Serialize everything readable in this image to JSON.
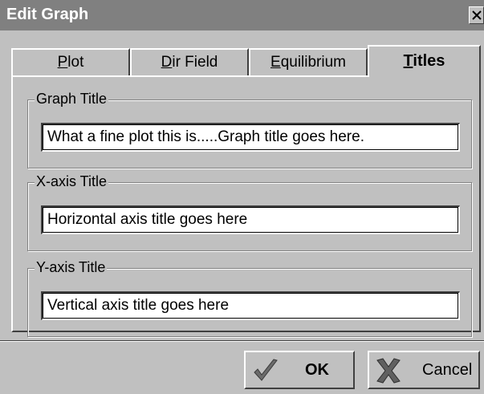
{
  "window": {
    "title": "Edit Graph",
    "close_glyph": "✕"
  },
  "tabs": [
    {
      "label_mnemonic": "P",
      "label_rest": "lot",
      "active": false
    },
    {
      "label_mnemonic": "D",
      "label_rest": "ir Field",
      "active": false
    },
    {
      "label_mnemonic": "E",
      "label_rest": "quilibrium",
      "active": false
    },
    {
      "label_mnemonic": "T",
      "label_rest": "itles",
      "active": true
    }
  ],
  "groups": {
    "graph_title": {
      "legend": "Graph Title",
      "value": "What a fine plot this is.....Graph title goes here."
    },
    "x_axis_title": {
      "legend": "X-axis Title",
      "value": "Horizontal axis title goes here"
    },
    "y_axis_title": {
      "legend": "Y-axis Title",
      "value": "Vertical axis title goes here"
    }
  },
  "buttons": {
    "ok": {
      "label": "OK",
      "icon": "checkmark-icon"
    },
    "cancel": {
      "label": "Cancel",
      "icon": "x-icon"
    }
  },
  "colors": {
    "face": "#c0c0c0",
    "titlebar": "#808080",
    "ok_check": "#6b6b6b",
    "cancel_x": "#606060"
  }
}
